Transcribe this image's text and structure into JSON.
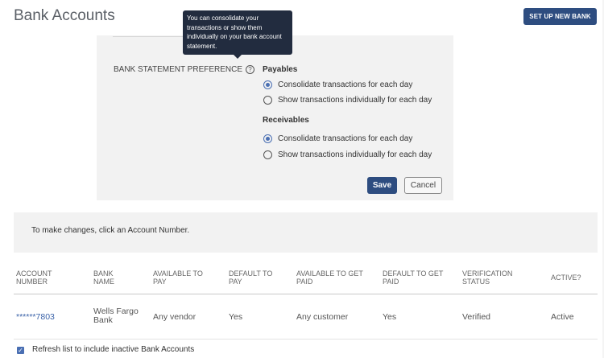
{
  "page_title": "Bank Accounts",
  "setup_button": "SET UP NEW BANK",
  "tooltip": "You can consolidate your transactions or show them individually on your bank account statement.",
  "preference_label": "BANK STATEMENT PREFERENCE",
  "payables": {
    "title": "Payables",
    "options": [
      "Consolidate transactions for each day",
      "Show transactions individually for each day"
    ],
    "selected": 0
  },
  "receivables": {
    "title": "Receivables",
    "options": [
      "Consolidate transactions for each day",
      "Show transactions individually for each day"
    ],
    "selected": 0
  },
  "save_label": "Save",
  "cancel_label": "Cancel",
  "info_text": "To make changes, click an Account Number.",
  "table": {
    "headers": [
      [
        "ACCOUNT",
        "NUMBER"
      ],
      [
        "BANK",
        "NAME"
      ],
      [
        "AVAILABLE TO",
        "PAY"
      ],
      [
        "DEFAULT TO",
        "PAY"
      ],
      [
        "AVAILABLE TO GET",
        "PAID"
      ],
      [
        "DEFAULT TO GET",
        "PAID"
      ],
      [
        "VERIFICATION",
        "STATUS"
      ],
      [
        "ACTIVE?",
        ""
      ]
    ],
    "rows": [
      {
        "account_number": "******7803",
        "bank_name": [
          "Wells Fargo",
          "Bank"
        ],
        "available_to_pay": "Any vendor",
        "default_to_pay": "Yes",
        "available_to_get_paid": "Any customer",
        "default_to_get_paid": "Yes",
        "verification_status": "Verified",
        "active": "Active"
      }
    ]
  },
  "refresh_label": "Refresh list to include inactive Bank Accounts",
  "refresh_checked": true,
  "colors": {
    "primary": "#2e4d80",
    "accent": "#4a6fb3",
    "tooltip_bg": "#222c3f"
  }
}
